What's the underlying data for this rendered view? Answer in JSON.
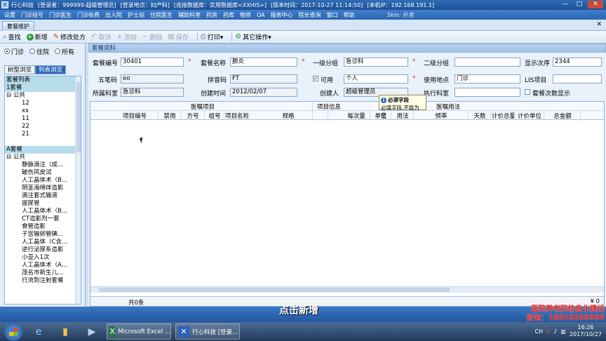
{
  "window": {
    "title_segments": [
      "行心科技",
      "[登录者：999999-超级管理员]",
      "[登录地点：妇产科]",
      "[连接数据库：实用数据库<XXHIS>]",
      "[版本时间：2017-10-27 11:14:50]",
      "[本机IP：192.168.191.1]"
    ],
    "controls": [
      "—",
      "□",
      "✕"
    ]
  },
  "menu": {
    "items": [
      "设置",
      "门诊挂号",
      "门诊医生",
      "门诊收费",
      "出入院",
      "护士站",
      "住院医生",
      "辅助科室",
      "药房",
      "药库",
      "物资",
      "OA",
      "报表中心",
      "院长查询",
      "窗口",
      "帮助"
    ],
    "skin_label": "Skin: 扑克"
  },
  "tab": {
    "label": "套餐维护",
    "close": "✕"
  },
  "toolbar": {
    "buttons": [
      {
        "icon": "⌕",
        "label": "查找",
        "enabled": true
      },
      {
        "icon": "+",
        "label": "新增",
        "enabled": true
      },
      {
        "icon": "✎",
        "label": "修改处方",
        "enabled": true
      },
      {
        "icon": "↶",
        "label": "取消",
        "enabled": false
      },
      {
        "icon": "+",
        "label": "添加",
        "enabled": false
      },
      {
        "icon": "−",
        "label": "删除",
        "enabled": false
      },
      {
        "icon": "▤",
        "label": "保存",
        "enabled": false
      },
      {
        "icon": "⎙",
        "label": "打印▾",
        "enabled": true
      },
      {
        "icon": "⚙",
        "label": "其它操作▾",
        "enabled": true
      }
    ]
  },
  "left": {
    "radios": [
      {
        "label": "门诊",
        "checked": true
      },
      {
        "label": "住院",
        "checked": false
      },
      {
        "label": "所有",
        "checked": false
      }
    ],
    "tabs": [
      "树型浏览",
      "列表浏览"
    ],
    "tree": [
      {
        "text": "套餐列表",
        "indent": 0,
        "hl": true
      },
      {
        "text": "1套餐",
        "indent": 0,
        "hl": true
      },
      {
        "text": "⊟ 公共",
        "indent": 0,
        "hl": false
      },
      {
        "text": "12",
        "indent": 22,
        "hl": false
      },
      {
        "text": "xx",
        "indent": 22,
        "hl": false
      },
      {
        "text": "11",
        "indent": 22,
        "hl": false
      },
      {
        "text": "22",
        "indent": 22,
        "hl": false
      },
      {
        "text": "21",
        "indent": 22,
        "hl": false
      },
      {
        "text": "",
        "indent": 0,
        "hl": false
      },
      {
        "text": "A套餐",
        "indent": 0,
        "hl": true
      },
      {
        "text": "⊟ 公共",
        "indent": 0,
        "hl": false
      },
      {
        "text": "静脉滴注（成...",
        "indent": 22,
        "hl": false
      },
      {
        "text": "破伤风皮试",
        "indent": 22,
        "hl": false
      },
      {
        "text": "人工晶体术（B...",
        "indent": 22,
        "hl": false
      },
      {
        "text": "阴茎海绵体造影",
        "indent": 22,
        "hl": false
      },
      {
        "text": "滴注套式输液",
        "indent": 22,
        "hl": false
      },
      {
        "text": "拔尿管",
        "indent": 22,
        "hl": false
      },
      {
        "text": "人工晶体术（B...",
        "indent": 22,
        "hl": false
      },
      {
        "text": "CT造影剂一套",
        "indent": 22,
        "hl": false
      },
      {
        "text": "食管造影",
        "indent": 22,
        "hl": false
      },
      {
        "text": "子宫输卵管碘...",
        "indent": 22,
        "hl": false
      },
      {
        "text": "人工晶体（C含...",
        "indent": 22,
        "hl": false
      },
      {
        "text": "逆行泌尿系造影",
        "indent": 22,
        "hl": false
      },
      {
        "text": "小壶入1次",
        "indent": 22,
        "hl": false
      },
      {
        "text": "人工晶体术（A...",
        "indent": 22,
        "hl": false
      },
      {
        "text": "茂名市新生儿...",
        "indent": 22,
        "hl": false
      },
      {
        "text": "行流到注射套餐",
        "indent": 22,
        "hl": false
      }
    ]
  },
  "form": {
    "section_title": "套餐资料",
    "fields": {
      "code_label": "套餐编号",
      "code_value": "30401",
      "name_label": "套餐名称",
      "name_value": "肺炎",
      "group1_label": "一级分组",
      "group1_value": "急诊科",
      "group2_label": "二级分组",
      "group2_value": "",
      "order_label": "显示次序",
      "order_value": "2344",
      "wubi_label": "五笔码",
      "wubi_value": "eo",
      "pinyin_label": "拼音码",
      "pinyin_value": "FT",
      "usable_label": "可用",
      "personal_value": "个人",
      "place_label": "使用地点",
      "place_value": "门诊",
      "lis_label": "LIS项目",
      "lis_value": "",
      "dept_label": "所属科室",
      "dept_value": "急诊科",
      "created_label": "创建时间",
      "created_value": "2012/02/07",
      "creator_label": "创建人",
      "creator_value": "超级管理员",
      "exec_label": "执行科室",
      "exec_value": "",
      "count_label": "套餐次数显示"
    },
    "required_mark": "*"
  },
  "tooltip": {
    "title": "必添字段",
    "text": "必填字段,不能为空"
  },
  "grid": {
    "group_headers": [
      "医嘱项目",
      "项目信息",
      "医嘱用法"
    ],
    "columns": [
      "项目编号",
      "禁用",
      "方号",
      "组号",
      "项目名称",
      "规格",
      "每次量",
      "单位",
      "用法",
      "频率",
      "天数",
      "计价总量",
      "计价单位",
      "总金额"
    ],
    "footer_count": "共0条",
    "footer_total": "¥ 0"
  },
  "overlay": {
    "subtitle": "点击新增",
    "watermark_line1": "医院养老院信息化建设",
    "watermark_line2": "咨询：18819289996"
  },
  "taskbar": {
    "tasks": [
      {
        "icon": "X",
        "label": "Microsoft Excel ..."
      },
      {
        "icon": "✕",
        "label": "行心科技 [登录..."
      }
    ],
    "lang": "CH",
    "time": "16:26",
    "date": "2017/10/27"
  }
}
